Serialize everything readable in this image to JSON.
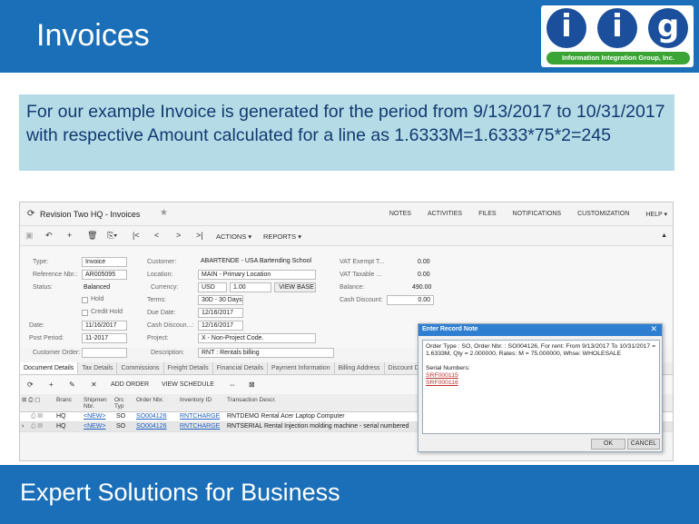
{
  "header": {
    "title": "Invoices"
  },
  "logo": {
    "letters": [
      "i",
      "i",
      "g"
    ],
    "tagline": "Information Integration Group, Inc."
  },
  "note": {
    "text": "For our example Invoice is generated for the period from 9/13/2017 to 10/31/2017 with respective Amount calculated for a line as 1.6333M=1.6333*75*2=245"
  },
  "app": {
    "title": "Revision Two HQ - Invoices",
    "topnav": [
      "NOTES",
      "ACTIVITIES",
      "FILES",
      "NOTIFICATIONS",
      "CUSTOMIZATION",
      "HELP ▾"
    ],
    "toolbar": {
      "actions": "ACTIONS ▾",
      "reports": "REPORTS ▾"
    },
    "form": {
      "type_label": "Type:",
      "type_value": "Invoice",
      "refnbr_label": "Reference Nbr.:",
      "refnbr_value": "AR005095",
      "status_label": "Status:",
      "status_value": "Balanced",
      "hold_label": "Hold",
      "credit_hold_label": "Credit Hold",
      "date_label": "Date:",
      "date_value": "11/16/2017",
      "postperiod_label": "Post Period:",
      "postperiod_value": "11-2017",
      "customer_order_label": "Customer Order:",
      "customer_label": "Customer:",
      "customer_value": "ABARTENDE - USA Bartending School",
      "location_label": "Location:",
      "location_value": "MAIN - Primary Location",
      "currency_label": "Currency:",
      "currency_value": "USD",
      "rate_value": "1.00",
      "view_base": "VIEW BASE",
      "terms_label": "Terms:",
      "terms_value": "30D - 30 Days",
      "duedate_label": "Due Date:",
      "duedate_value": "12/16/2017",
      "cashdisc_label": "Cash Discoun...:",
      "cashdisc_value": "12/16/2017",
      "project_label": "Project:",
      "project_value": "X - Non-Project Code.",
      "description_label": "Description:",
      "description_value": "RNT : Rentals billing",
      "vat_exempt_label": "VAT Exempt T...",
      "vat_exempt_value": "0.00",
      "vat_taxable_label": "VAT Taxable ...",
      "vat_taxable_value": "0.00",
      "balance_label": "Balance:",
      "balance_value": "490.00",
      "cash_discount_label": "Cash Discount:",
      "cash_discount_value": "0.00"
    },
    "tabs": [
      "Document Details",
      "Tax Details",
      "Commissions",
      "Freight Details",
      "Financial Details",
      "Payment Information",
      "Billing Address",
      "Discount Det"
    ],
    "gridbar": {
      "add_order": "ADD ORDER",
      "view_schedule": "VIEW SCHEDULE"
    },
    "grid": {
      "headers": [
        "Branc",
        "Shipmen Nbr.",
        "Orc Typ",
        "Order Nbr.",
        "Inventory ID",
        "Transaction Descr."
      ],
      "rows": [
        {
          "branch": "HQ",
          "shipment": "<NEW>",
          "ordtype": "SO",
          "ordernbr": "SO004126",
          "inventory": "RNTCHARGE",
          "descr": "RNTDEMO Rental Acer Laptop Computer"
        },
        {
          "branch": "HQ",
          "shipment": "<NEW>",
          "ordtype": "SO",
          "ordernbr": "SO004126",
          "inventory": "RNTCHARGE",
          "descr": "RNTSERIAL Rental Injection molding machine - serial numbered"
        }
      ]
    },
    "dialog": {
      "title": "Enter Record Note",
      "body": "Order Type : SO, Order Nbr. : SO004126, For rent: From 9/13/2017 To 10/31/2017 = 1.6333M, Qty = 2.000000, Rates: M = 75.000000, Whse: WHOLESALE",
      "serials_label": "Serial Numbers:",
      "serials": [
        "SRF000115",
        "SRF000116"
      ],
      "ok": "OK",
      "cancel": "CANCEL"
    }
  },
  "footer": {
    "text": "Expert Solutions for Business"
  },
  "colors": {
    "band": "#1b6fb8",
    "note_bg": "#b4dbe6",
    "logo_green": "#3aa535",
    "logo_blue": "#1b4f9c"
  }
}
